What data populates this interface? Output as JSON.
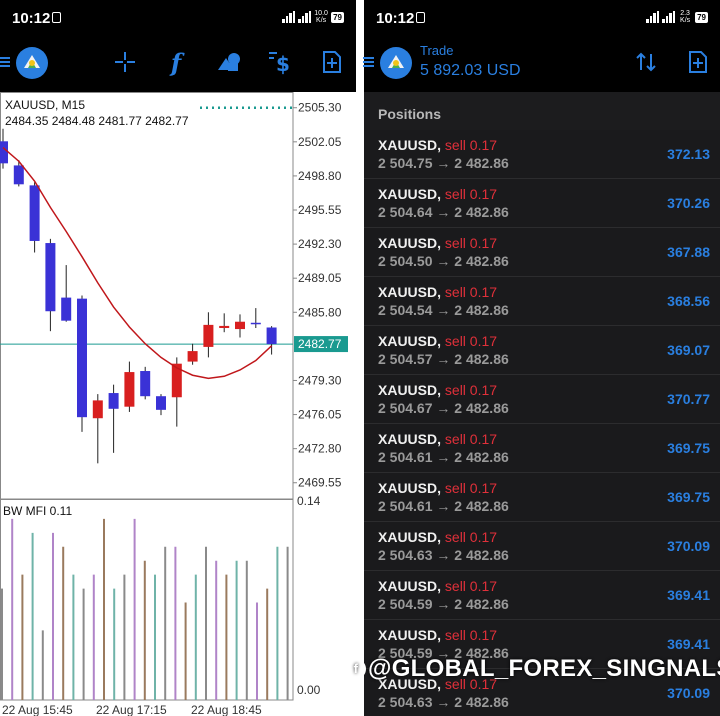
{
  "status": {
    "left_time": "10:12",
    "left_netspeed": "10.0",
    "left_netunit": "K/s",
    "right_time": "10:12",
    "right_netspeed": "2.3",
    "right_netunit": "K/s",
    "network": "4G",
    "battery": "79"
  },
  "chart": {
    "symbol_tf": "XAUUSD, M15",
    "ohlc": "2484.35 2484.48 2481.77 2482.77",
    "current_price": "2482.77",
    "price_ticks": [
      "2505.30",
      "2502.05",
      "2498.80",
      "2495.55",
      "2492.30",
      "2489.05",
      "2485.80",
      "2479.30",
      "2476.05",
      "2472.80",
      "2469.55"
    ],
    "indicator_label": "BW MFI 0.11",
    "indicator_max": "0.14",
    "indicator_min": "0.00",
    "time_labels": [
      "22 Aug 15:45",
      "22 Aug 17:15",
      "22 Aug 18:45"
    ]
  },
  "chart_data": {
    "type": "candlestick",
    "title": "XAUUSD, M15",
    "ylim": [
      2468,
      2506.8
    ],
    "ma_line_level": 2505.3,
    "candles": [
      {
        "o": 2502.1,
        "h": 2503.3,
        "l": 2499.5,
        "c": 2500.0
      },
      {
        "o": 2499.8,
        "h": 2500.3,
        "l": 2497.8,
        "c": 2498.0
      },
      {
        "o": 2497.9,
        "h": 2498.2,
        "l": 2491.5,
        "c": 2492.6
      },
      {
        "o": 2492.4,
        "h": 2492.8,
        "l": 2484.0,
        "c": 2485.9
      },
      {
        "o": 2487.2,
        "h": 2490.3,
        "l": 2484.9,
        "c": 2485.0
      },
      {
        "o": 2487.1,
        "h": 2487.4,
        "l": 2474.4,
        "c": 2475.8
      },
      {
        "o": 2475.7,
        "h": 2478.0,
        "l": 2471.4,
        "c": 2477.4
      },
      {
        "o": 2478.1,
        "h": 2478.9,
        "l": 2472.4,
        "c": 2476.6
      },
      {
        "o": 2476.8,
        "h": 2481.1,
        "l": 2476.3,
        "c": 2480.1
      },
      {
        "o": 2480.2,
        "h": 2480.6,
        "l": 2477.5,
        "c": 2477.8
      },
      {
        "o": 2477.8,
        "h": 2478.0,
        "l": 2476.0,
        "c": 2476.5
      },
      {
        "o": 2477.7,
        "h": 2481.5,
        "l": 2474.9,
        "c": 2480.9
      },
      {
        "o": 2481.1,
        "h": 2482.8,
        "l": 2480.8,
        "c": 2482.1
      },
      {
        "o": 2482.5,
        "h": 2485.8,
        "l": 2481.5,
        "c": 2484.6
      },
      {
        "o": 2484.3,
        "h": 2485.7,
        "l": 2483.9,
        "c": 2484.5
      },
      {
        "o": 2484.2,
        "h": 2485.6,
        "l": 2483.4,
        "c": 2484.9
      },
      {
        "o": 2484.8,
        "h": 2486.2,
        "l": 2484.3,
        "c": 2484.7
      },
      {
        "o": 2484.35,
        "h": 2484.48,
        "l": 2481.77,
        "c": 2482.77
      }
    ],
    "ma": [
      2501.5,
      2500.2,
      2498.3,
      2495.8,
      2493.5,
      2491.1,
      2488.6,
      2486.3,
      2484.4,
      2482.8,
      2481.5,
      2480.5,
      2479.8,
      2479.5,
      2479.7,
      2480.3,
      2481.2,
      2482.6
    ],
    "bw_mfi": {
      "ylim": [
        0,
        0.14
      ],
      "values": [
        0.08,
        0.13,
        0.09,
        0.12,
        0.05,
        0.12,
        0.11,
        0.09,
        0.08,
        0.09,
        0.13,
        0.08,
        0.09,
        0.13,
        0.1,
        0.09,
        0.11,
        0.11,
        0.07,
        0.09,
        0.11,
        0.1,
        0.09,
        0.1,
        0.1,
        0.07,
        0.08,
        0.11,
        0.11
      ]
    }
  },
  "trade": {
    "title": "Trade",
    "balance": "5 892.03 USD",
    "positions_header": "Positions",
    "positions": [
      {
        "symbol": "XAUUSD,",
        "side": "sell 0.17",
        "prices": "2 504.75 → 2 482.86",
        "profit": "372.13"
      },
      {
        "symbol": "XAUUSD,",
        "side": "sell 0.17",
        "prices": "2 504.64 → 2 482.86",
        "profit": "370.26"
      },
      {
        "symbol": "XAUUSD,",
        "side": "sell 0.17",
        "prices": "2 504.50 → 2 482.86",
        "profit": "367.88"
      },
      {
        "symbol": "XAUUSD,",
        "side": "sell 0.17",
        "prices": "2 504.54 → 2 482.86",
        "profit": "368.56"
      },
      {
        "symbol": "XAUUSD,",
        "side": "sell 0.17",
        "prices": "2 504.57 → 2 482.86",
        "profit": "369.07"
      },
      {
        "symbol": "XAUUSD,",
        "side": "sell 0.17",
        "prices": "2 504.67 → 2 482.86",
        "profit": "370.77"
      },
      {
        "symbol": "XAUUSD,",
        "side": "sell 0.17",
        "prices": "2 504.61 → 2 482.86",
        "profit": "369.75"
      },
      {
        "symbol": "XAUUSD,",
        "side": "sell 0.17",
        "prices": "2 504.61 → 2 482.86",
        "profit": "369.75"
      },
      {
        "symbol": "XAUUSD,",
        "side": "sell 0.17",
        "prices": "2 504.63 → 2 482.86",
        "profit": "370.09"
      },
      {
        "symbol": "XAUUSD,",
        "side": "sell 0.17",
        "prices": "2 504.59 → 2 482.86",
        "profit": "369.41"
      },
      {
        "symbol": "XAUUSD,",
        "side": "sell 0.17",
        "prices": "2 504.59 → 2 482.86",
        "profit": "369.41"
      },
      {
        "symbol": "XAUUSD,",
        "side": "sell 0.17",
        "prices": "2 504.63 → 2 482.86",
        "profit": "370.09"
      }
    ]
  },
  "watermark": "@GLOBAL_FOREX_SINGNALS",
  "colors": {
    "accent": "#2a7fe0",
    "bear": "#3a32d6",
    "bull": "#d81f1f",
    "ma": "#c0171b",
    "price_line": "#1a9a90",
    "sell": "#e0303a"
  }
}
